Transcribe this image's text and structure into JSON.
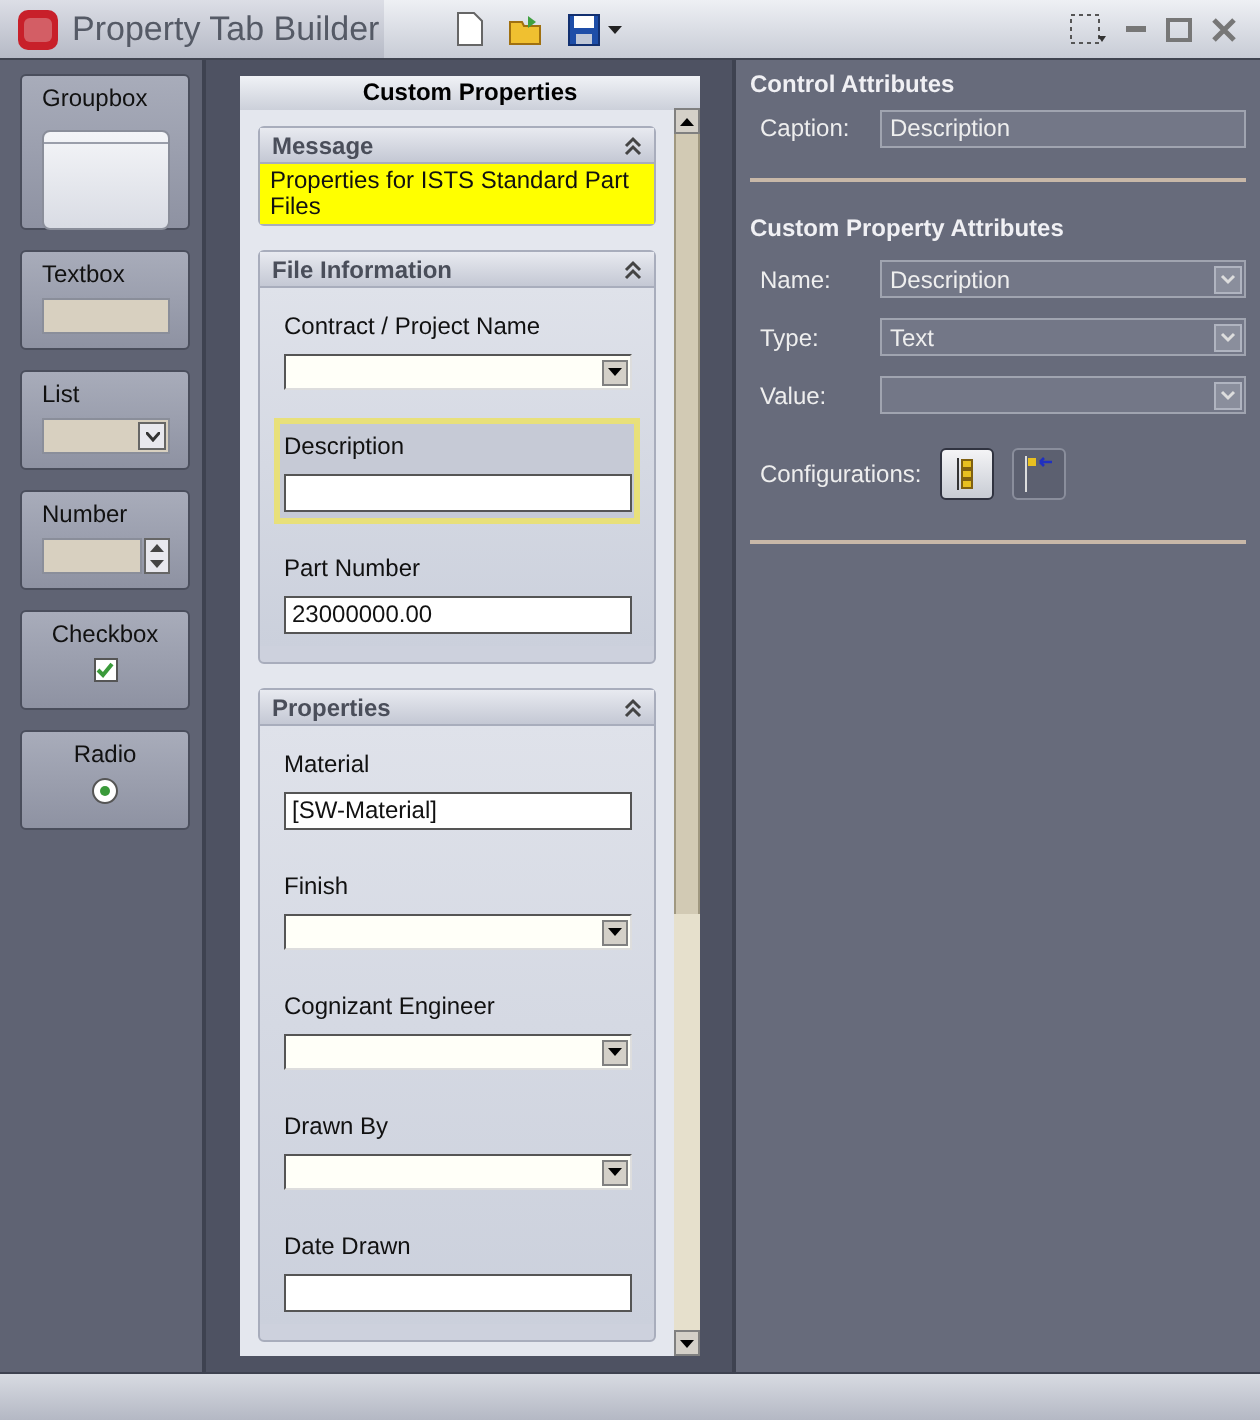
{
  "window": {
    "title": "Property Tab Builder"
  },
  "palette": [
    {
      "kind": "groupbox",
      "label": "Groupbox"
    },
    {
      "kind": "textbox",
      "label": "Textbox"
    },
    {
      "kind": "list",
      "label": "List"
    },
    {
      "kind": "number",
      "label": "Number"
    },
    {
      "kind": "checkbox",
      "label": "Checkbox",
      "checked": true
    },
    {
      "kind": "radio",
      "label": "Radio",
      "selected": true
    }
  ],
  "form": {
    "title": "Custom Properties",
    "groups": [
      {
        "title": "Message",
        "kind": "message",
        "text": "Properties for ISTS Standard Part Files"
      },
      {
        "title": "File Information",
        "kind": "fields",
        "fields": [
          {
            "label": "Contract / Project Name",
            "kind": "combo",
            "selected": false
          },
          {
            "label": "Description",
            "kind": "text",
            "selected": true
          },
          {
            "label": "Part Number",
            "kind": "text",
            "value": "23000000.00",
            "selected": false
          }
        ]
      },
      {
        "title": "Properties",
        "kind": "fields",
        "fields": [
          {
            "label": "Material",
            "kind": "text",
            "value": "[SW-Material]",
            "selected": false
          },
          {
            "label": "Finish",
            "kind": "combo",
            "selected": false
          },
          {
            "label": "Cognizant Engineer",
            "kind": "combo",
            "selected": false
          },
          {
            "label": "Drawn By",
            "kind": "combo",
            "selected": false
          },
          {
            "label": "Date Drawn",
            "kind": "text",
            "selected": false
          }
        ]
      }
    ]
  },
  "control_attributes": {
    "title": "Control Attributes",
    "caption_label": "Caption:",
    "caption_value": "Description"
  },
  "custom_property_attributes": {
    "title": "Custom Property Attributes",
    "rows": [
      {
        "label": "Name:",
        "value": "Description"
      },
      {
        "label": "Type:",
        "value": "Text"
      },
      {
        "label": "Value:"
      }
    ],
    "configurations_label": "Configurations:",
    "configurations": [
      {
        "kind": "list",
        "selected": true
      },
      {
        "kind": "flag",
        "selected": false
      }
    ]
  }
}
